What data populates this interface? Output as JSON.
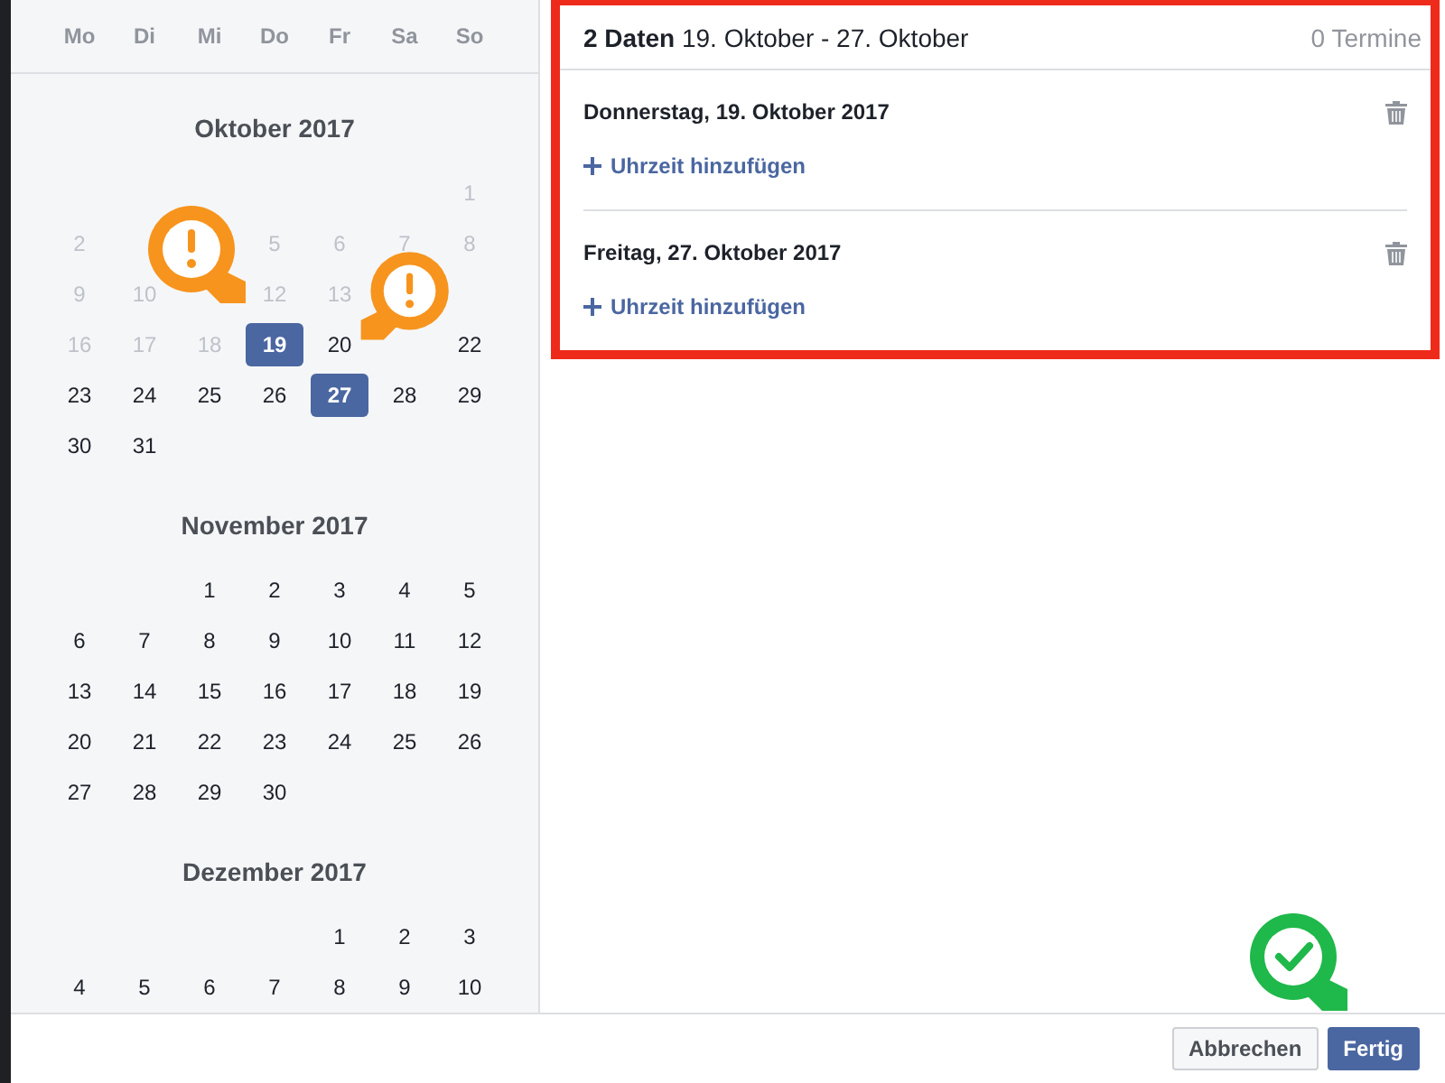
{
  "weekdays": [
    "Mo",
    "Di",
    "Mi",
    "Do",
    "Fr",
    "Sa",
    "So"
  ],
  "months": [
    {
      "title": "Oktober 2017",
      "weeks": [
        [
          {
            "kind": "empty"
          },
          {
            "kind": "empty"
          },
          {
            "kind": "empty"
          },
          {
            "kind": "empty"
          },
          {
            "kind": "empty"
          },
          {
            "kind": "empty"
          },
          {
            "kind": "day",
            "day": "1",
            "disabled": true,
            "selected": false
          }
        ],
        [
          {
            "kind": "day",
            "day": "2",
            "disabled": true,
            "selected": false
          },
          {
            "kind": "empty"
          },
          {
            "kind": "empty"
          },
          {
            "kind": "day",
            "day": "5",
            "disabled": true,
            "selected": false
          },
          {
            "kind": "day",
            "day": "6",
            "disabled": true,
            "selected": false
          },
          {
            "kind": "day",
            "day": "7",
            "disabled": true,
            "selected": false
          },
          {
            "kind": "day",
            "day": "8",
            "disabled": true,
            "selected": false
          }
        ],
        [
          {
            "kind": "day",
            "day": "9",
            "disabled": true,
            "selected": false
          },
          {
            "kind": "day",
            "day": "10",
            "disabled": true,
            "selected": false
          },
          {
            "kind": "empty"
          },
          {
            "kind": "day",
            "day": "12",
            "disabled": true,
            "selected": false
          },
          {
            "kind": "day",
            "day": "13",
            "disabled": true,
            "selected": false
          },
          {
            "kind": "empty"
          },
          {
            "kind": "empty"
          }
        ],
        [
          {
            "kind": "day",
            "day": "16",
            "disabled": true,
            "selected": false
          },
          {
            "kind": "day",
            "day": "17",
            "disabled": true,
            "selected": false
          },
          {
            "kind": "day",
            "day": "18",
            "disabled": true,
            "selected": false
          },
          {
            "kind": "day",
            "day": "19",
            "disabled": false,
            "selected": true
          },
          {
            "kind": "day",
            "day": "20",
            "disabled": false,
            "selected": false
          },
          {
            "kind": "empty"
          },
          {
            "kind": "day",
            "day": "22",
            "disabled": false,
            "selected": false
          }
        ],
        [
          {
            "kind": "day",
            "day": "23",
            "disabled": false,
            "selected": false
          },
          {
            "kind": "day",
            "day": "24",
            "disabled": false,
            "selected": false
          },
          {
            "kind": "day",
            "day": "25",
            "disabled": false,
            "selected": false
          },
          {
            "kind": "day",
            "day": "26",
            "disabled": false,
            "selected": false
          },
          {
            "kind": "day",
            "day": "27",
            "disabled": false,
            "selected": true
          },
          {
            "kind": "day",
            "day": "28",
            "disabled": false,
            "selected": false
          },
          {
            "kind": "day",
            "day": "29",
            "disabled": false,
            "selected": false
          }
        ],
        [
          {
            "kind": "day",
            "day": "30",
            "disabled": false,
            "selected": false
          },
          {
            "kind": "day",
            "day": "31",
            "disabled": false,
            "selected": false
          }
        ]
      ]
    },
    {
      "title": "November 2017",
      "weeks": [
        [
          {
            "kind": "empty"
          },
          {
            "kind": "empty"
          },
          {
            "kind": "day",
            "day": "1",
            "disabled": false,
            "selected": false
          },
          {
            "kind": "day",
            "day": "2",
            "disabled": false,
            "selected": false
          },
          {
            "kind": "day",
            "day": "3",
            "disabled": false,
            "selected": false
          },
          {
            "kind": "day",
            "day": "4",
            "disabled": false,
            "selected": false
          },
          {
            "kind": "day",
            "day": "5",
            "disabled": false,
            "selected": false
          }
        ],
        [
          {
            "kind": "day",
            "day": "6",
            "disabled": false,
            "selected": false
          },
          {
            "kind": "day",
            "day": "7",
            "disabled": false,
            "selected": false
          },
          {
            "kind": "day",
            "day": "8",
            "disabled": false,
            "selected": false
          },
          {
            "kind": "day",
            "day": "9",
            "disabled": false,
            "selected": false
          },
          {
            "kind": "day",
            "day": "10",
            "disabled": false,
            "selected": false
          },
          {
            "kind": "day",
            "day": "11",
            "disabled": false,
            "selected": false
          },
          {
            "kind": "day",
            "day": "12",
            "disabled": false,
            "selected": false
          }
        ],
        [
          {
            "kind": "day",
            "day": "13",
            "disabled": false,
            "selected": false
          },
          {
            "kind": "day",
            "day": "14",
            "disabled": false,
            "selected": false
          },
          {
            "kind": "day",
            "day": "15",
            "disabled": false,
            "selected": false
          },
          {
            "kind": "day",
            "day": "16",
            "disabled": false,
            "selected": false
          },
          {
            "kind": "day",
            "day": "17",
            "disabled": false,
            "selected": false
          },
          {
            "kind": "day",
            "day": "18",
            "disabled": false,
            "selected": false
          },
          {
            "kind": "day",
            "day": "19",
            "disabled": false,
            "selected": false
          }
        ],
        [
          {
            "kind": "day",
            "day": "20",
            "disabled": false,
            "selected": false
          },
          {
            "kind": "day",
            "day": "21",
            "disabled": false,
            "selected": false
          },
          {
            "kind": "day",
            "day": "22",
            "disabled": false,
            "selected": false
          },
          {
            "kind": "day",
            "day": "23",
            "disabled": false,
            "selected": false
          },
          {
            "kind": "day",
            "day": "24",
            "disabled": false,
            "selected": false
          },
          {
            "kind": "day",
            "day": "25",
            "disabled": false,
            "selected": false
          },
          {
            "kind": "day",
            "day": "26",
            "disabled": false,
            "selected": false
          }
        ],
        [
          {
            "kind": "day",
            "day": "27",
            "disabled": false,
            "selected": false
          },
          {
            "kind": "day",
            "day": "28",
            "disabled": false,
            "selected": false
          },
          {
            "kind": "day",
            "day": "29",
            "disabled": false,
            "selected": false
          },
          {
            "kind": "day",
            "day": "30",
            "disabled": false,
            "selected": false
          }
        ]
      ]
    },
    {
      "title": "Dezember 2017",
      "weeks": [
        [
          {
            "kind": "empty"
          },
          {
            "kind": "empty"
          },
          {
            "kind": "empty"
          },
          {
            "kind": "empty"
          },
          {
            "kind": "day",
            "day": "1",
            "disabled": false,
            "selected": false
          },
          {
            "kind": "day",
            "day": "2",
            "disabled": false,
            "selected": false
          },
          {
            "kind": "day",
            "day": "3",
            "disabled": false,
            "selected": false
          }
        ],
        [
          {
            "kind": "day",
            "day": "4",
            "disabled": false,
            "selected": false
          },
          {
            "kind": "day",
            "day": "5",
            "disabled": false,
            "selected": false
          },
          {
            "kind": "day",
            "day": "6",
            "disabled": false,
            "selected": false
          },
          {
            "kind": "day",
            "day": "7",
            "disabled": false,
            "selected": false
          },
          {
            "kind": "day",
            "day": "8",
            "disabled": false,
            "selected": false
          },
          {
            "kind": "day",
            "day": "9",
            "disabled": false,
            "selected": false
          },
          {
            "kind": "day",
            "day": "10",
            "disabled": false,
            "selected": false
          }
        ]
      ]
    }
  ],
  "summary": {
    "heading": "**2 Daten** 19. Oktober - 27. Oktober",
    "appointments": "0 Termine"
  },
  "dates": [
    {
      "label": "Donnerstag, 19. Oktober 2017",
      "action": "Uhrzeit hinzufügen"
    },
    {
      "label": "Freitag, 27. Oktober 2017",
      "action": "Uhrzeit hinzufügen"
    }
  ],
  "buttons": [
    {
      "label": "Abbrechen",
      "kind": "secondary"
    },
    {
      "label": "Fertig",
      "kind": "primary"
    }
  ],
  "markers": [
    {
      "kind": "warning"
    },
    {
      "kind": "warning"
    },
    {
      "kind": "success"
    }
  ]
}
